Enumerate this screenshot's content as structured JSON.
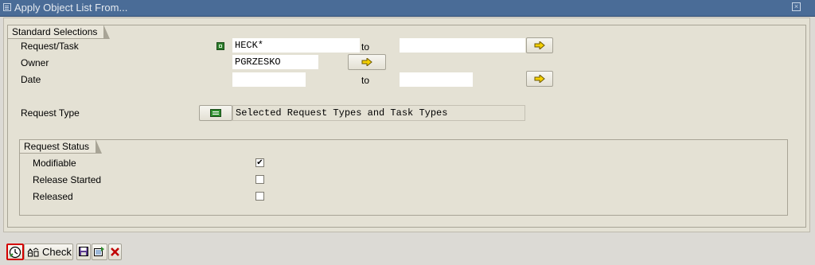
{
  "window": {
    "title": "Apply Object List From..."
  },
  "standard_selections": {
    "title": "Standard Selections",
    "request_task": {
      "label": "Request/Task",
      "from_value": "HECK*",
      "to_label": "to",
      "to_value": ""
    },
    "owner": {
      "label": "Owner",
      "value": "PGRZESKO"
    },
    "date": {
      "label": "Date",
      "from_value": "",
      "to_label": "to",
      "to_value": ""
    },
    "request_type": {
      "label": "Request Type",
      "value": "Selected Request Types and Task Types"
    }
  },
  "request_status": {
    "title": "Request Status",
    "items": [
      {
        "label": "Modifiable",
        "checked": true
      },
      {
        "label": "Release Started",
        "checked": false
      },
      {
        "label": "Released",
        "checked": false
      }
    ]
  },
  "toolbar": {
    "check_label": "Check",
    "icons": [
      "execute-icon",
      "check-icon",
      "save-icon",
      "load-icon",
      "cancel-icon"
    ]
  },
  "colors": {
    "title_bar": "#4a6c97",
    "panel": "#e4e1d4",
    "cancel": "#c00000",
    "focus": "#d40000"
  }
}
